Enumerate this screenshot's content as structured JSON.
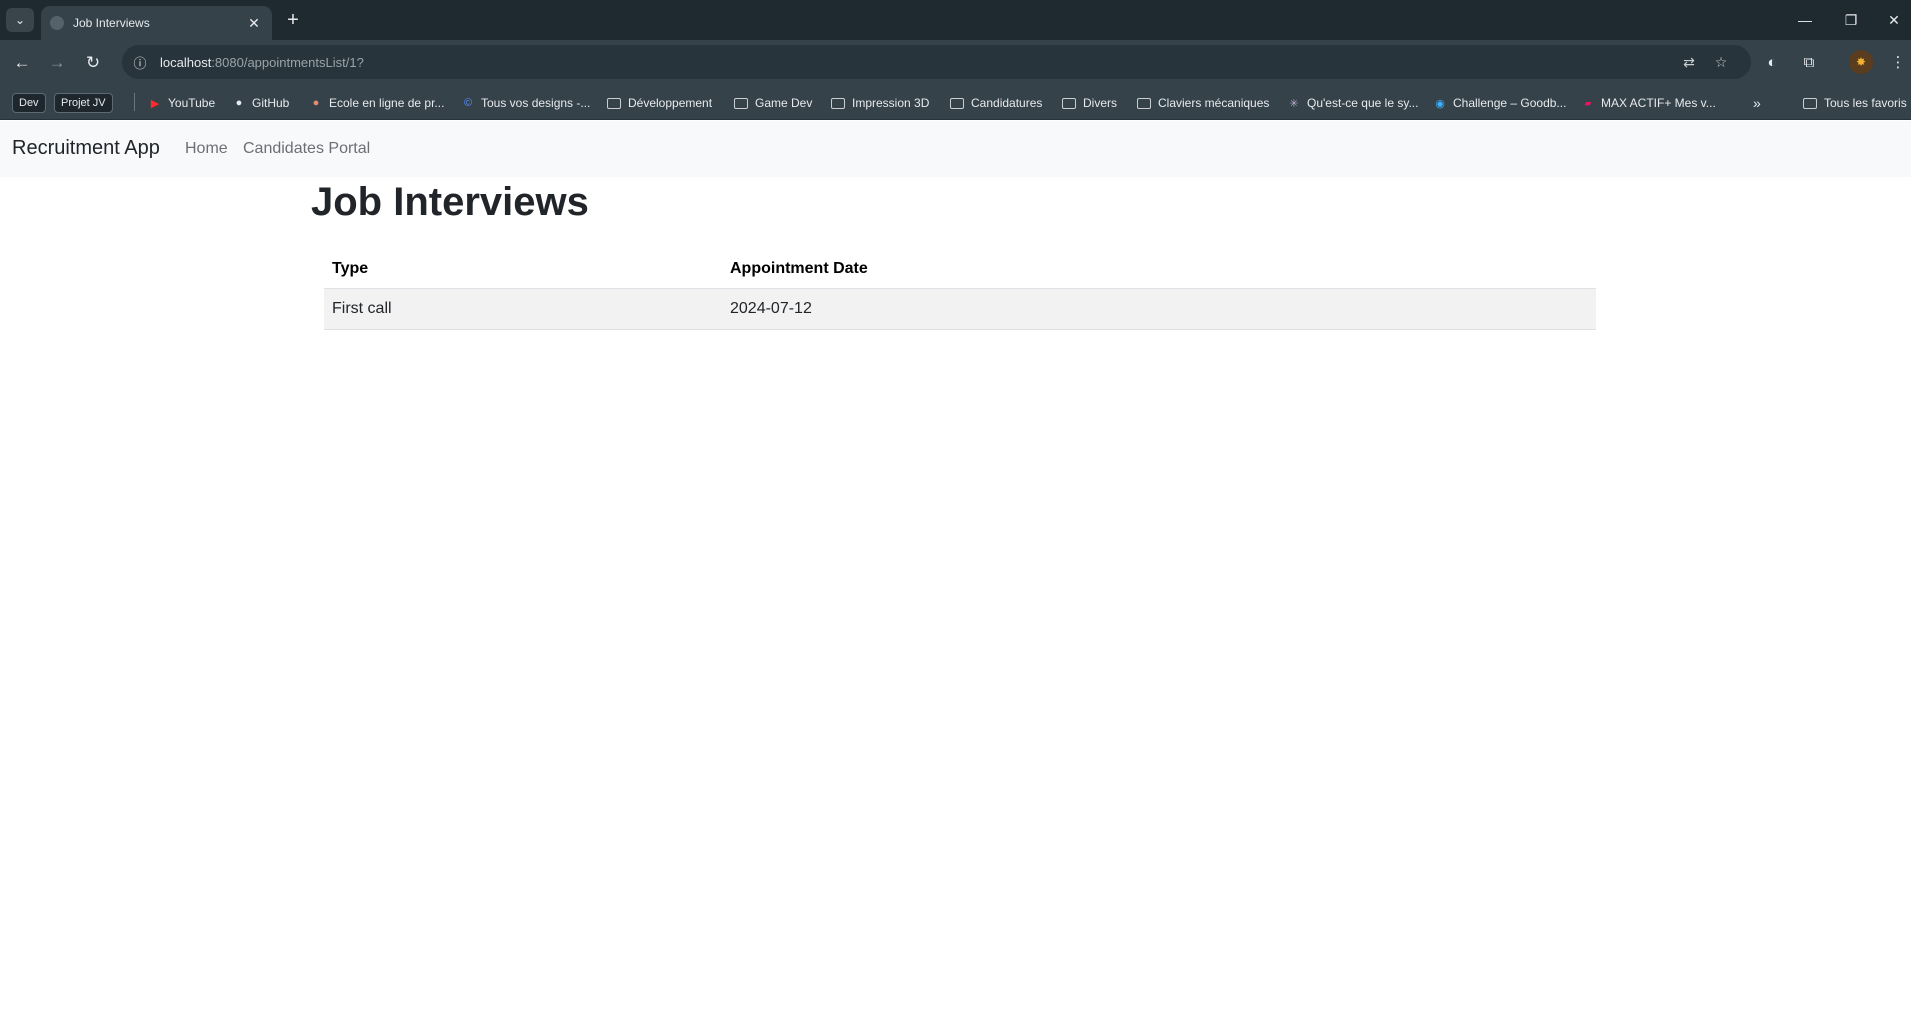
{
  "browser": {
    "tab_title": "Job Interviews",
    "url_host": "localhost",
    "url_path": ":8080/appointmentsList/1?",
    "bookmarks": {
      "dev": "Dev",
      "projet_jv": "Projet JV",
      "youtube": "YouTube",
      "github": "GitHub",
      "ecole": "Ecole en ligne de pr...",
      "designs": "Tous vos designs -...",
      "developpement": "Développement",
      "game_dev": "Game Dev",
      "impression": "Impression 3D",
      "candidatures": "Candidatures",
      "divers": "Divers",
      "claviers": "Claviers mécaniques",
      "quest": "Qu'est-ce que le sy...",
      "challenge": "Challenge – Goodb...",
      "max": "MAX ACTIF+ Mes v...",
      "tous_favoris": "Tous les favoris"
    }
  },
  "app": {
    "brand": "Recruitment App",
    "nav": {
      "home": "Home",
      "candidates": "Candidates Portal"
    }
  },
  "page": {
    "title": "Job Interviews",
    "table": {
      "headers": {
        "type": "Type",
        "date": "Appointment Date"
      },
      "rows": [
        {
          "type": "First call",
          "date": "2024-07-12"
        }
      ]
    }
  }
}
